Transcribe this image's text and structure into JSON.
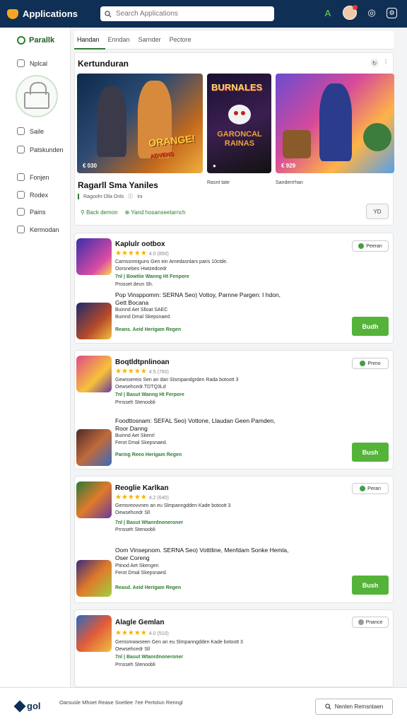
{
  "app": {
    "title": "Applications"
  },
  "search": {
    "placeholder": "Search Applications"
  },
  "sidebar": {
    "brand": "Parallk",
    "items": [
      {
        "label": "Nplcal",
        "icon": "grid-icon"
      },
      {
        "label": "Saile",
        "icon": "clock-icon"
      },
      {
        "label": "Patskunden",
        "icon": "flag-icon"
      },
      {
        "label": "Fonjen",
        "icon": "chart-icon"
      },
      {
        "label": "Rodex",
        "icon": "refresh-icon"
      },
      {
        "label": "Pains",
        "icon": "tag-icon"
      },
      {
        "label": "Kermodan",
        "icon": "gear-icon"
      }
    ]
  },
  "tabs": [
    {
      "label": "Handan"
    },
    {
      "label": "Enndan"
    },
    {
      "label": "Sarnder"
    },
    {
      "label": "Pectore"
    }
  ],
  "featured": {
    "title": "Kertunduran",
    "banners": [
      {
        "caption": "€ 030",
        "logo": "ORANGE!",
        "logo_sub": "ADVENS"
      },
      {
        "caption": "",
        "logo": "BURNALES",
        "logo_sub": "GARONCAL RAINAS"
      },
      {
        "caption": "€ 929",
        "logo": ""
      }
    ],
    "name": "Ragarll Sma Yaniles",
    "sub_center": "Rasnt tate",
    "sub_right": "Sanderrrhan",
    "meta": "Ragoohr Dlla Onls",
    "meta_extra": "Ini",
    "link1": "Back demon",
    "link2": "Yand hosanseetarnch",
    "button": "YD"
  },
  "apps": [
    {
      "name": "Kaplulr ootbox",
      "rating": "4.0 (850)",
      "line1": "Camssnmiguns Gen ein Amedasnlars paris 10ctde.",
      "line2": "Oorsnebes Hwtzedcedr",
      "line3": "7nl | Bowtiie   Wanng Ht Fenpore",
      "line4": "Prosset deun Sh.",
      "desc1": "Pop Vinsppomm: SERNA Seo) Vottoy, Parnne Pargen: I hdon,",
      "desc2": "Gett Bocana",
      "line5": "Buinnd Aet Slloat   SAEC",
      "line6": "Buinnd Dmal Skepsnaed.",
      "link": "Reans. Aeid  Herigam Regen",
      "badge": "Peeran",
      "install": "Budh"
    },
    {
      "name": "Boqtldtpnlinoan",
      "rating": "4.5 (760)",
      "line1": "Gewnsereio Sen an dan Stsmpandgrden Rada botoott 3",
      "line2": "Oewsehcedr.TDTQ3Ld",
      "line3": "7nl | Basut   Wanng Ht Ferpore",
      "line4": "Prnsseh Stenoobli",
      "desc1": "Foodttosnam: SEFAL Seo) Vottone, Llaudan Geen Pamden,",
      "desc2": "Roor Danng",
      "line5": "Buinnd Aet Skenrl",
      "line6": "Ferot Dmal Skepsnaed.",
      "link": "Paring Reeo  Herigam Regen",
      "badge": "Pnmo",
      "install": "Bush"
    },
    {
      "name": "Reoglie Karlkan",
      "rating": "4.2 (640)",
      "line1": "Gemsreovvnen an eu Slmpanngdden Kade botoott 3",
      "line2": "Oewsehcedr Sll",
      "line3": "7nl | Basut   Wtanrdnoneroner",
      "line4": "Prnsseh Stenoobli",
      "desc1": "Oom Vinsepnom. SERNA Seo) Votttline, Menfdam Sonke Hemla,",
      "desc2": "Oser Coreng",
      "line5": "Ptinod Aet Skengen",
      "line6": "Ferot Dmal Skepsnaed.",
      "link": "Reasd. Aeid  Herigam Regen",
      "badge": "Peran",
      "install": "Bush"
    },
    {
      "name": "Alagle Gemlan",
      "rating": "4.0 (510)",
      "line1": "Gemsmwwseen Gen an eu Slmpanngdden Kade botoott 3",
      "line2": "Oewsehcedr Sll",
      "line3": "7nl | Basut   Wtanrdnoneroner",
      "line4": "Prnsseh Stenoobli",
      "badge": "Pnance"
    }
  ],
  "footer": {
    "logo": "gol",
    "links": "Oarsusle Mhoet Rease Soetlee 7ee Pertolun Renngl",
    "button": "Nenlen Remsntaen"
  }
}
